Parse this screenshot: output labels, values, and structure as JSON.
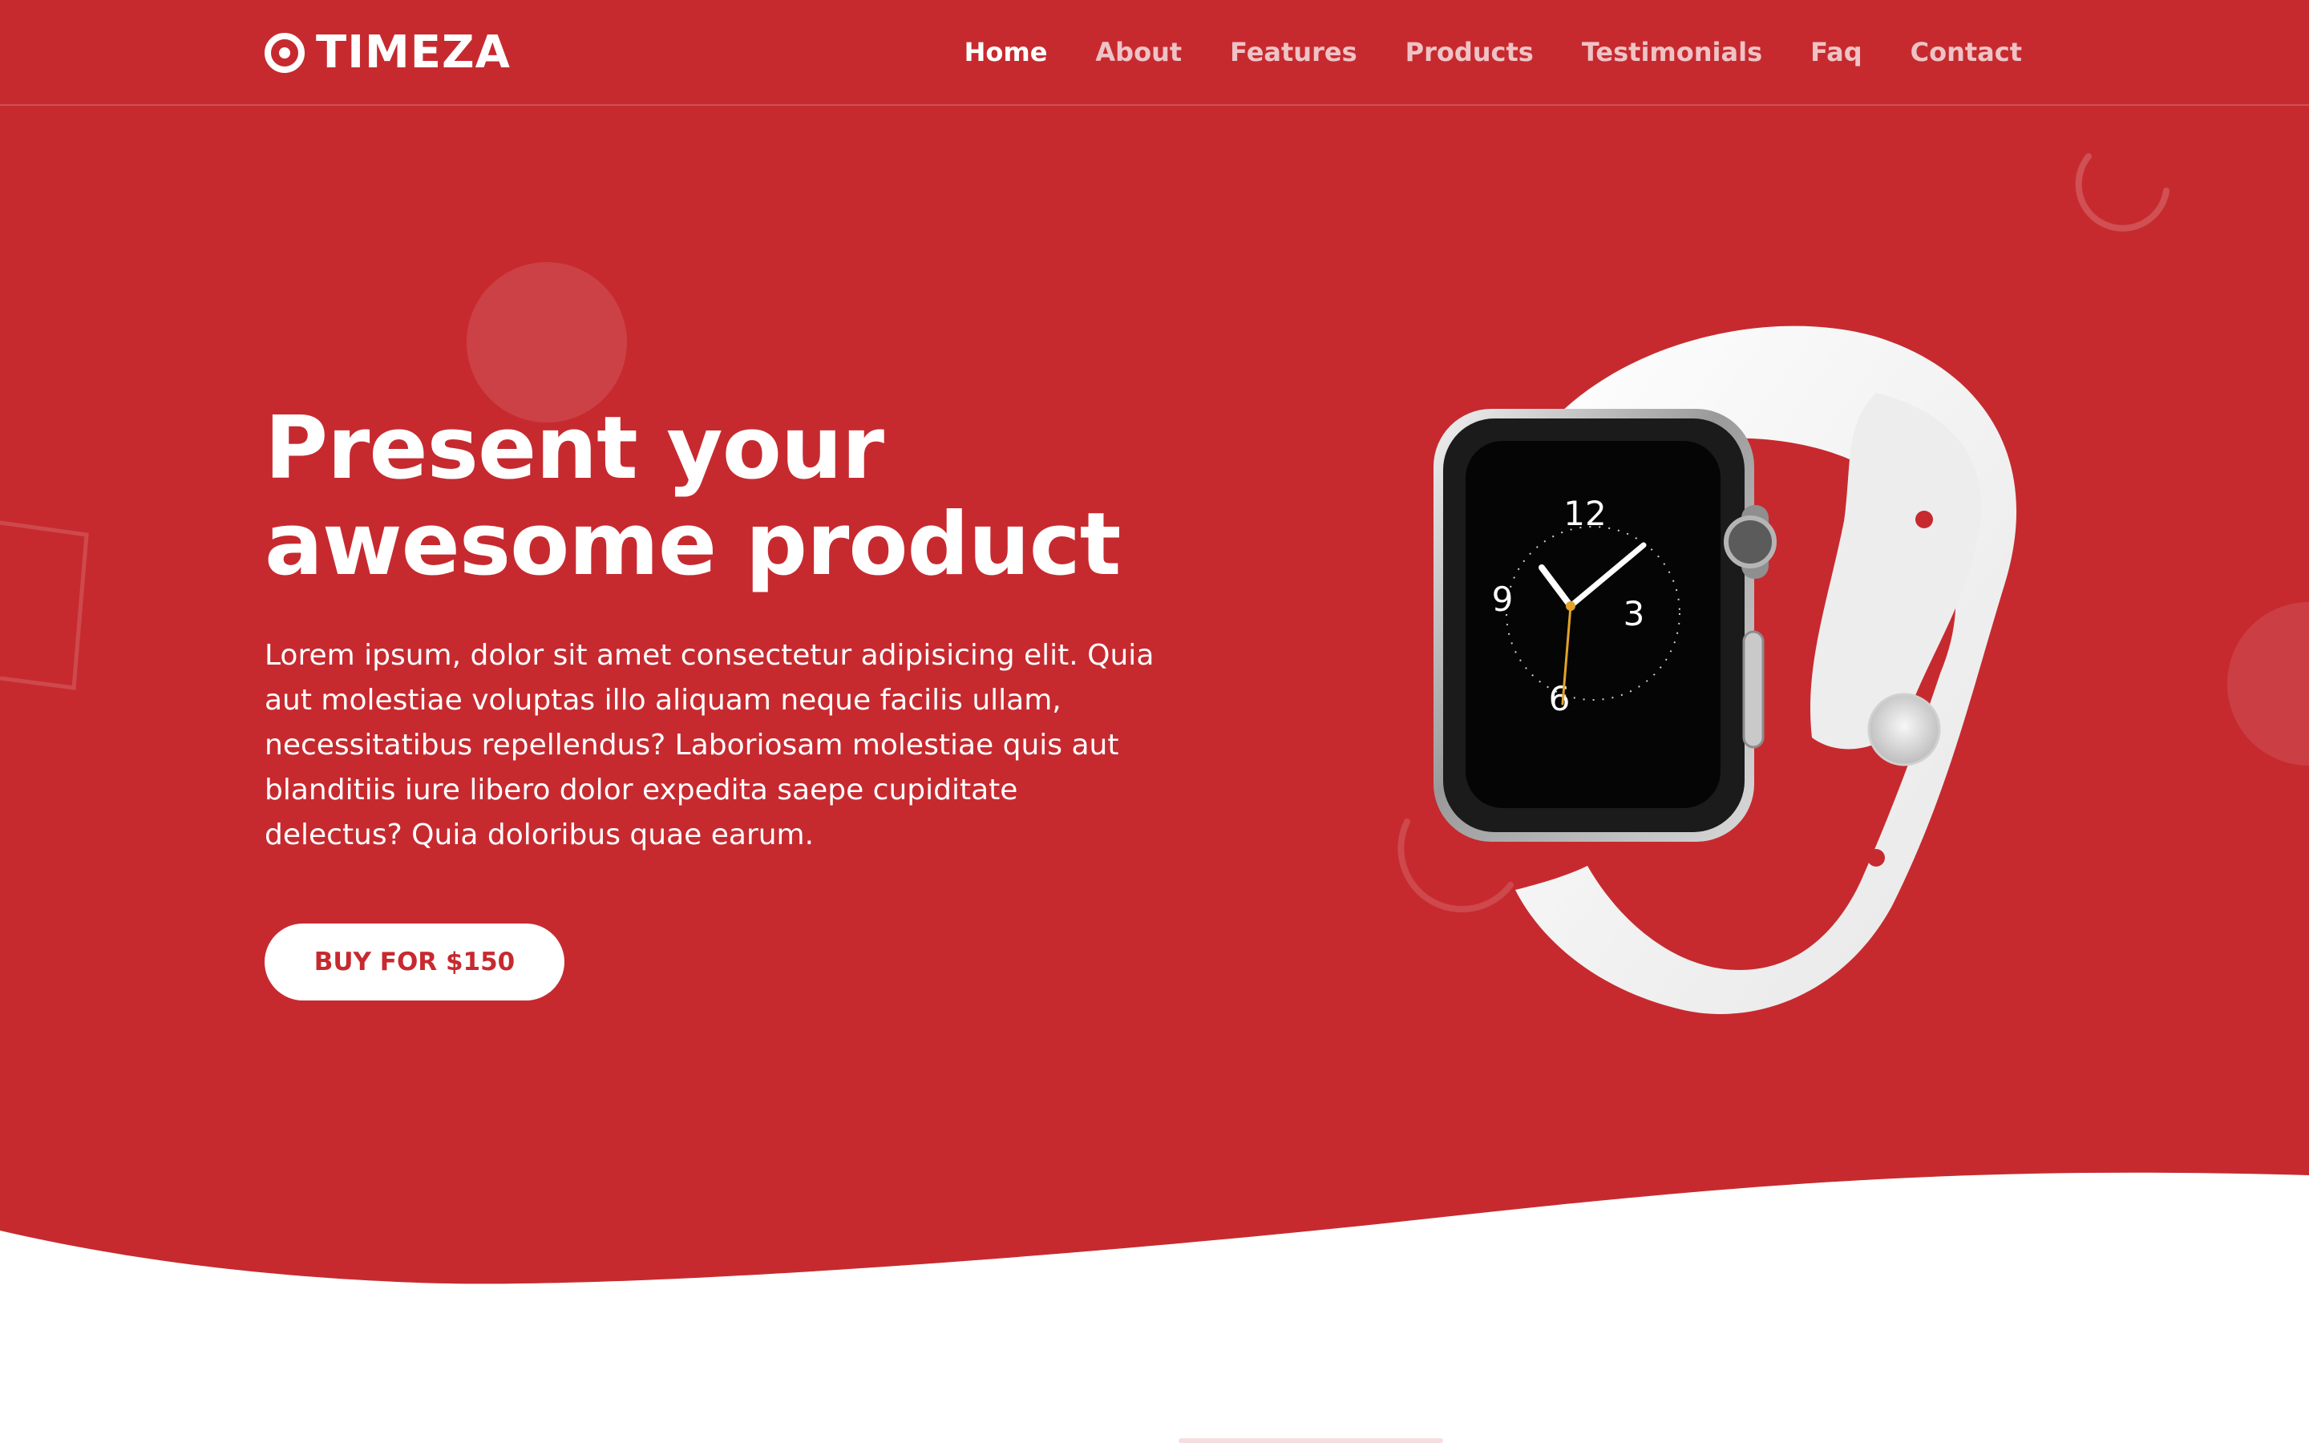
{
  "brand": {
    "name": "TIMEZA",
    "icon": "target-icon"
  },
  "nav": {
    "items": [
      {
        "label": "Home",
        "active": true
      },
      {
        "label": "About",
        "active": false
      },
      {
        "label": "Features",
        "active": false
      },
      {
        "label": "Products",
        "active": false
      },
      {
        "label": "Testimonials",
        "active": false
      },
      {
        "label": "Faq",
        "active": false
      },
      {
        "label": "Contact",
        "active": false
      }
    ]
  },
  "hero": {
    "title_line1": "Present your",
    "title_line2": "awesome product",
    "description": "Lorem ipsum, dolor sit amet consectetur adipisicing elit. Quia aut molestiae voluptas illo aliquam neque facilis ullam, necessitatibus repellendus? Laboriosam molestiae quis aut blanditiis iure libero dolor expedita saepe cupiditate delectus? Quia doloribus quae earum.",
    "cta_label": "BUY FOR $150"
  },
  "watch": {
    "dial_numbers": [
      "12",
      "3",
      "6",
      "9"
    ]
  },
  "colors": {
    "primary": "#c62a2f",
    "text_on_primary": "#ffffff",
    "button_bg": "#ffffff"
  }
}
